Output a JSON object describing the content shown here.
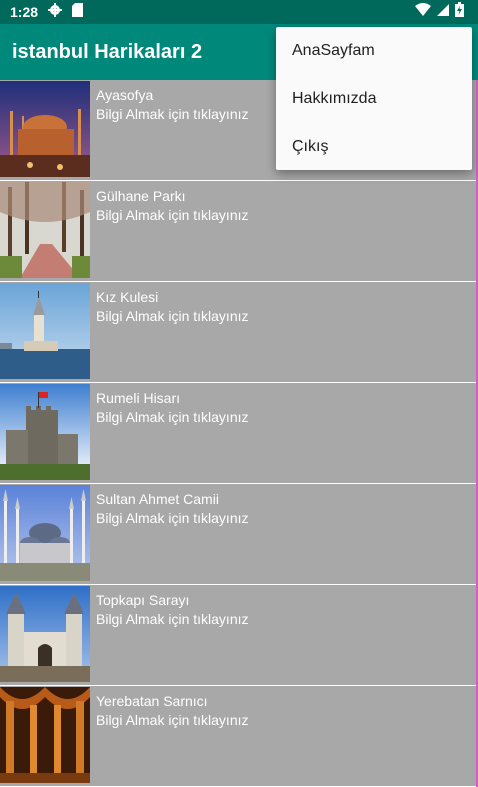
{
  "status_bar": {
    "time": "1:28",
    "icons": [
      "settings-icon",
      "sd-card-icon",
      "wifi-icon",
      "cell-signal-icon",
      "battery-icon"
    ]
  },
  "app_bar": {
    "title": "istanbul Harikaları 2"
  },
  "menu": {
    "items": [
      {
        "label": "AnaSayfam"
      },
      {
        "label": "Hakkımızda"
      },
      {
        "label": "Çıkış"
      }
    ]
  },
  "list": {
    "items": [
      {
        "title": "Ayasofya",
        "subtitle": "Bilgi Almak için tıklayınız"
      },
      {
        "title": "Gülhane Parkı",
        "subtitle": "Bilgi Almak için tıklayınız"
      },
      {
        "title": "Kız Kulesi",
        "subtitle": "Bilgi Almak için tıklayınız"
      },
      {
        "title": "Rumeli Hisarı",
        "subtitle": "Bilgi Almak için tıklayınız"
      },
      {
        "title": "Sultan Ahmet Camii",
        "subtitle": "Bilgi Almak için tıklayınız"
      },
      {
        "title": "Topkapı Sarayı",
        "subtitle": "Bilgi Almak için tıklayınız"
      },
      {
        "title": "Yerebatan Sarnıcı",
        "subtitle": "Bilgi Almak için tıklayınız"
      }
    ]
  },
  "colors": {
    "status_bar": "#00695c",
    "app_bar": "#00897b",
    "list_background": "#a8a8a8",
    "menu_background": "#fafafa"
  }
}
